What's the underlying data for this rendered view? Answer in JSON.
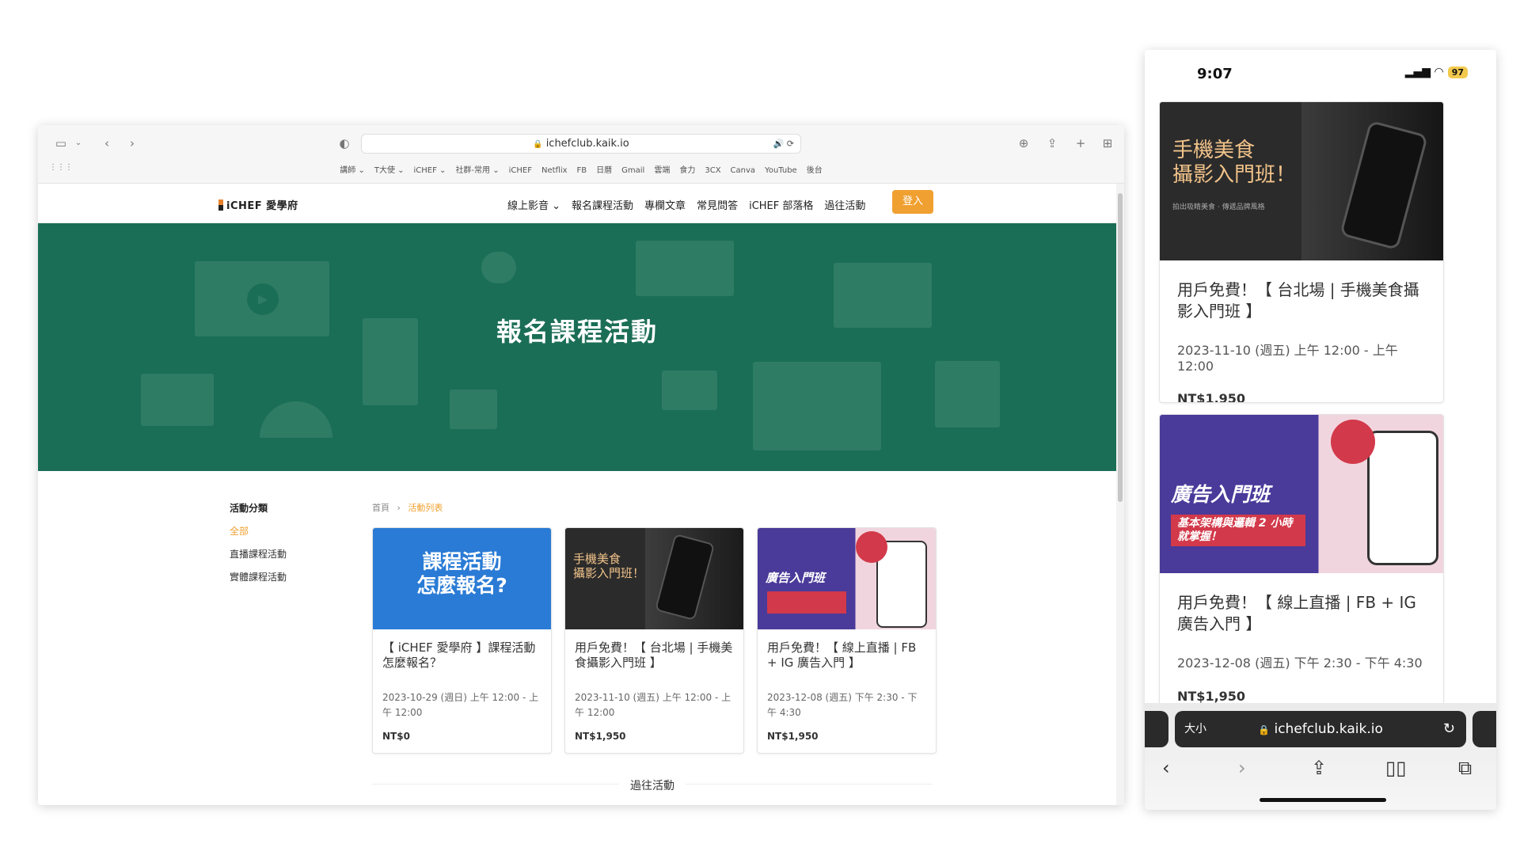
{
  "browser": {
    "url": "ichefclub.kaik.io",
    "bookmarks": [
      "講師 ⌄",
      "T大使 ⌄",
      "iCHEF ⌄",
      "社群-常用 ⌄",
      "iCHEF",
      "Netflix",
      "FB",
      "日曆",
      "Gmail",
      "雲端",
      "食力",
      "3CX",
      "Canva",
      "YouTube",
      "後台"
    ]
  },
  "site": {
    "logo": "iCHEF 愛學府",
    "menu": [
      "線上影音 ⌄",
      "報名課程活動",
      "專欄文章",
      "常見問答",
      "iCHEF 部落格",
      "過往活動"
    ],
    "login": "登入",
    "hero_title": "報名課程活動"
  },
  "sidebar": {
    "heading": "活動分類",
    "items": [
      "全部",
      "直播課程活動",
      "實體課程活動"
    ]
  },
  "breadcrumb": {
    "home": "首頁",
    "sep": "›",
    "current": "活動列表"
  },
  "cards": [
    {
      "image_text": "課程活動\n怎麼報名?",
      "title": "【 iCHEF 愛學府 】課程活動怎麼報名？",
      "date": "2023-10-29 (週日) 上午 12:00 - 上午 12:00",
      "price": "NT$0"
    },
    {
      "image_text": "手機美食\n攝影入門班！",
      "title": "用戶免費！【 台北場 | 手機美食攝影入門班 】",
      "date": "2023-11-10 (週五) 上午 12:00 - 上午 12:00",
      "price": "NT$1,950"
    },
    {
      "image_text": "廣告入門班",
      "title": "用戶免費！【 線上直播 | FB + IG 廣告入門 】",
      "date": "2023-12-08 (週五) 下午 2:30 - 下午 4:30",
      "price": "NT$1,950"
    }
  ],
  "past_events": "過往活動",
  "phone": {
    "time": "9:07",
    "battery": "97",
    "cards": [
      {
        "image_text": "手機美食\n攝影入門班！",
        "sub": "拍出吸睛美食 · 傳遞品牌風格",
        "title": "用戶免費！【 台北場 | 手機美食攝影入門班 】",
        "date": "2023-11-10 (週五) 上午 12:00 - 上午 12:00",
        "price": "NT$1,950"
      },
      {
        "image_text": "廣告入門班",
        "sub": "基本架構與邏輯 2 小時就掌握！",
        "title": "用戶免費！【 線上直播 | FB + IG 廣告入門 】",
        "date": "2023-12-08 (週五) 下午 2:30 - 下午 4:30",
        "price": "NT$1,950"
      }
    ],
    "url_size": "大小",
    "url": "ichefclub.kaik.io"
  },
  "colors": {
    "hero": "#1b6e56",
    "accent": "#f0a030",
    "purple": "#4a3a9a",
    "blue": "#2a7bd5"
  }
}
